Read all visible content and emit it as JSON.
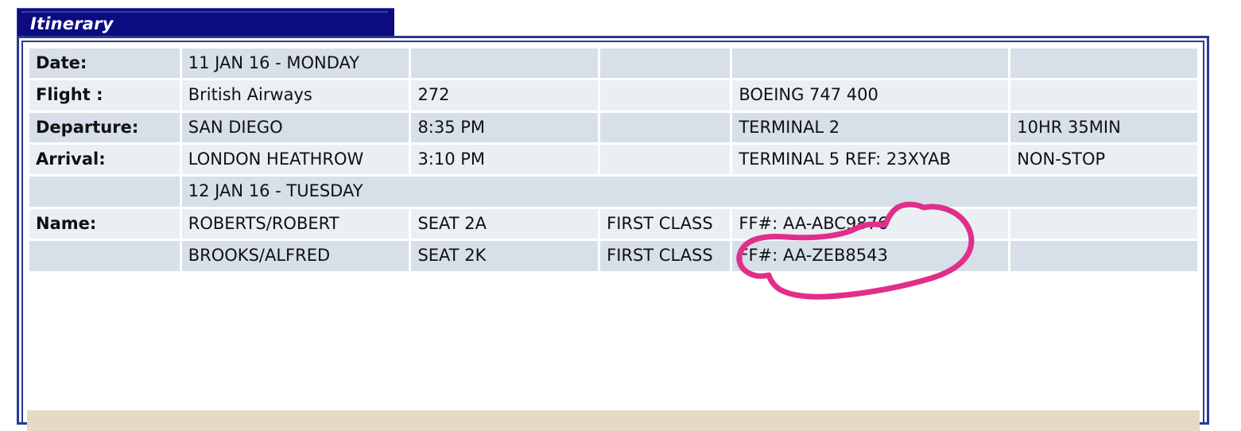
{
  "tab": {
    "label": "Itinerary"
  },
  "table": {
    "rows": [
      {
        "style": "dark",
        "cells": [
          {
            "name": "row-label-date",
            "text": "Date:",
            "bold": true
          },
          {
            "name": "date-value",
            "text": "11 JAN 16 - MONDAY"
          },
          {
            "name": "date-col3",
            "text": ""
          },
          {
            "name": "date-col4",
            "text": ""
          },
          {
            "name": "date-col5",
            "text": ""
          },
          {
            "name": "date-col6",
            "text": ""
          }
        ]
      },
      {
        "style": "light",
        "cells": [
          {
            "name": "row-label-flight",
            "text": "Flight :",
            "bold": true
          },
          {
            "name": "flight-airline",
            "text": "British Airways"
          },
          {
            "name": "flight-number",
            "text": "272"
          },
          {
            "name": "flight-col4",
            "text": ""
          },
          {
            "name": "flight-aircraft",
            "text": "BOEING 747 400"
          },
          {
            "name": "flight-col6",
            "text": ""
          }
        ]
      },
      {
        "style": "dark",
        "cells": [
          {
            "name": "row-label-departure",
            "text": "Departure:",
            "bold": true
          },
          {
            "name": "departure-city",
            "text": "SAN DIEGO"
          },
          {
            "name": "departure-time",
            "text": "8:35 PM"
          },
          {
            "name": "departure-col4",
            "text": ""
          },
          {
            "name": "departure-terminal",
            "text": "TERMINAL 2"
          },
          {
            "name": "flight-duration",
            "text": "10HR 35MIN"
          }
        ]
      },
      {
        "style": "light",
        "cells": [
          {
            "name": "row-label-arrival",
            "text": "Arrival:",
            "bold": true
          },
          {
            "name": "arrival-city",
            "text": "LONDON HEATHROW"
          },
          {
            "name": "arrival-time",
            "text": "3:10 PM"
          },
          {
            "name": "arrival-col4",
            "text": ""
          },
          {
            "name": "arrival-terminal-ref",
            "text": "TERMINAL 5 REF: 23XYAB"
          },
          {
            "name": "flight-stops",
            "text": "NON-STOP"
          }
        ]
      },
      {
        "style": "dark",
        "cells": [
          {
            "name": "arrival-date-label-blank",
            "text": ""
          },
          {
            "name": "arrival-date-value",
            "text": "12 JAN 16 - TUESDAY",
            "colspan": 5
          }
        ]
      },
      {
        "style": "light",
        "cells": [
          {
            "name": "row-label-name",
            "text": "Name:",
            "bold": true
          },
          {
            "name": "passenger-1-name",
            "text": "ROBERTS/ROBERT"
          },
          {
            "name": "passenger-1-seat",
            "text": "SEAT 2A"
          },
          {
            "name": "passenger-1-class",
            "text": "FIRST CLASS"
          },
          {
            "name": "passenger-1-frequent-flyer",
            "text": "FF#: AA-ABC9876"
          },
          {
            "name": "passenger-1-col6",
            "text": ""
          }
        ]
      },
      {
        "style": "dark",
        "cells": [
          {
            "name": "passenger-2-label-blank",
            "text": ""
          },
          {
            "name": "passenger-2-name",
            "text": "BROOKS/ALFRED"
          },
          {
            "name": "passenger-2-seat",
            "text": "SEAT 2K"
          },
          {
            "name": "passenger-2-class",
            "text": "FIRST CLASS"
          },
          {
            "name": "passenger-2-frequent-flyer",
            "text": "FF#: AA-ZEB8543"
          },
          {
            "name": "passenger-2-col6",
            "text": ""
          }
        ]
      }
    ]
  },
  "annotation": {
    "name": "pink-lasso-highlight",
    "target_text": "TERMINAL 5 REF: 23XYAB",
    "color": "#e02f8a"
  },
  "colors": {
    "tab_background": "#0c0c80",
    "panel_border": "#2a3a92",
    "row_dark": "#d7dfe8",
    "row_light": "#eaeff3",
    "footer_strip": "#e4dac5",
    "annotation_pink": "#e02f8a"
  }
}
